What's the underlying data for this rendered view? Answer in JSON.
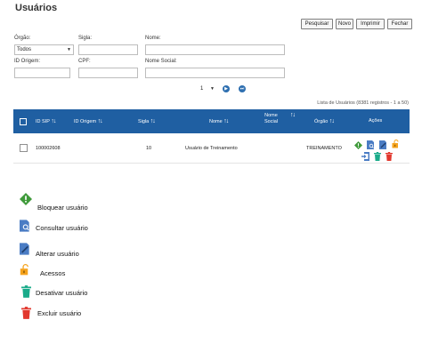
{
  "page": {
    "title": "Usuários"
  },
  "toolbar": {
    "pesquisar": "Pesquisar",
    "novo": "Novo",
    "imprimir": "Imprimir",
    "fechar": "Fechar"
  },
  "filters": {
    "orgao_label": "Órgão:",
    "orgao_value": "Todos",
    "sigla_label": "Sigla:",
    "nome_label": "Nome:",
    "id_origem_label": "ID Origem:",
    "cpf_label": "CPF:",
    "nome_social_label": "Nome Social:"
  },
  "pagination": {
    "page_value": "1"
  },
  "table": {
    "caption": "Lista de Usuários (8381 registros - 1 a 50)",
    "headers": {
      "id_sip": "ID SIP",
      "id_origem": "ID Origem",
      "sigla": "Sigla",
      "nome": "Nome",
      "nome_social_1": "Nome",
      "nome_social_2": "Social",
      "orgao": "Órgão",
      "acoes": "Ações"
    },
    "rows": [
      {
        "id_sip": "100002608",
        "id_origem": "",
        "sigla": "10",
        "nome": "Usuário de Treinamento",
        "nome_social": "",
        "orgao": "TREINAMENTO"
      }
    ]
  },
  "legend": {
    "bloquear": "Bloquear usuário",
    "consultar": "Consultar usuário",
    "alterar": "Alterar usuário",
    "acessos": "Acessos",
    "desativar": "Desativar usuário",
    "excluir": "Excluir usuário"
  },
  "colors": {
    "header": "#1f5fa2",
    "green": "#3f9a3a",
    "doc_blue": "#4a7cc4",
    "orange": "#f5a21b",
    "teal": "#1aab8a",
    "red": "#e2382e"
  }
}
